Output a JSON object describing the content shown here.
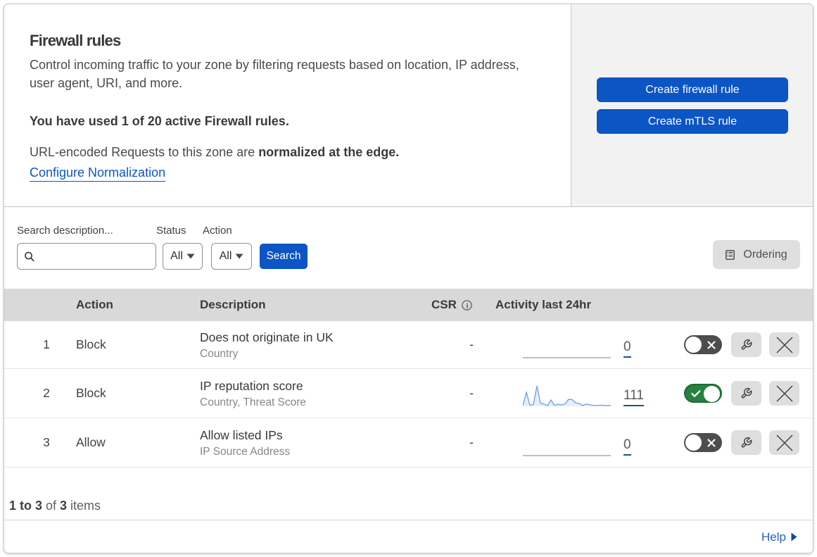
{
  "intro": {
    "title": "Firewall rules",
    "description": "Control incoming traffic to your zone by filtering requests based on location, IP address, user agent, URI, and more.",
    "usage": "You have used 1 of 20 active Firewall rules.",
    "normalization_prefix": "URL-encoded Requests to this zone are ",
    "normalization_bold": "normalized at the edge.",
    "normalization_link": "Configure Normalization"
  },
  "actions": {
    "create_firewall_rule": "Create firewall rule",
    "create_mtls_rule": "Create mTLS rule"
  },
  "filters": {
    "search_label": "Search description...",
    "status_label": "Status",
    "status_value": "All",
    "action_label": "Action",
    "action_value": "All",
    "search_button": "Search",
    "ordering_button": "Ordering"
  },
  "table": {
    "headers": {
      "action": "Action",
      "description": "Description",
      "csr": "CSR",
      "activity": "Activity last 24hr"
    },
    "rows": [
      {
        "index": "1",
        "action": "Block",
        "description": "Does not originate in UK",
        "criteria": "Country",
        "csr": "-",
        "activity_count": "0",
        "enabled": false
      },
      {
        "index": "2",
        "action": "Block",
        "description": "IP reputation score",
        "criteria": "Country, Threat Score",
        "csr": "-",
        "activity_count": "111",
        "enabled": true
      },
      {
        "index": "3",
        "action": "Allow",
        "description": "Allow listed IPs",
        "criteria": "IP Source Address",
        "csr": "-",
        "activity_count": "0",
        "enabled": false
      }
    ],
    "footer": {
      "range_bold": "1 to 3",
      "of_text": " of ",
      "total_bold": "3",
      "items_text": " items"
    }
  },
  "help_label": "Help",
  "chart_data": {
    "type": "area",
    "title": "Activity last 24hr sparklines",
    "series": [
      {
        "name": "Does not originate in UK",
        "count": 0,
        "values": [
          0,
          0,
          0,
          0,
          0,
          0,
          0,
          0,
          0,
          0,
          0,
          0,
          0,
          0,
          0,
          0,
          0,
          0,
          0,
          0,
          0,
          0,
          0,
          0,
          0,
          0
        ]
      },
      {
        "name": "IP reputation score",
        "count": 111,
        "values": [
          0.03,
          0.6,
          0.05,
          0.08,
          0.88,
          0.13,
          0.1,
          0.03,
          0.27,
          0.04,
          0.09,
          0.06,
          0.1,
          0.3,
          0.29,
          0.15,
          0.12,
          0.03,
          0.1,
          0.07,
          0.04,
          0.03,
          0.05,
          0.04,
          0.03,
          0.04
        ]
      },
      {
        "name": "Allow listed IPs",
        "count": 0,
        "values": [
          0,
          0,
          0,
          0,
          0,
          0,
          0,
          0,
          0,
          0,
          0,
          0,
          0,
          0,
          0,
          0,
          0,
          0,
          0,
          0,
          0,
          0,
          0,
          0,
          0,
          0
        ]
      }
    ],
    "line_color": "#6d9ee8",
    "fill_color": "#e7eefb",
    "zero_line_color": "#bfbfbf"
  },
  "colors": {
    "accent_blue": "#0b55c4",
    "link_blue": "#0b56c7",
    "toggle_on_green": "#27813f",
    "toggle_off_gray": "#4d4d4d",
    "header_band": "#d9d9d9",
    "panel_gray": "#f2f2f2"
  }
}
